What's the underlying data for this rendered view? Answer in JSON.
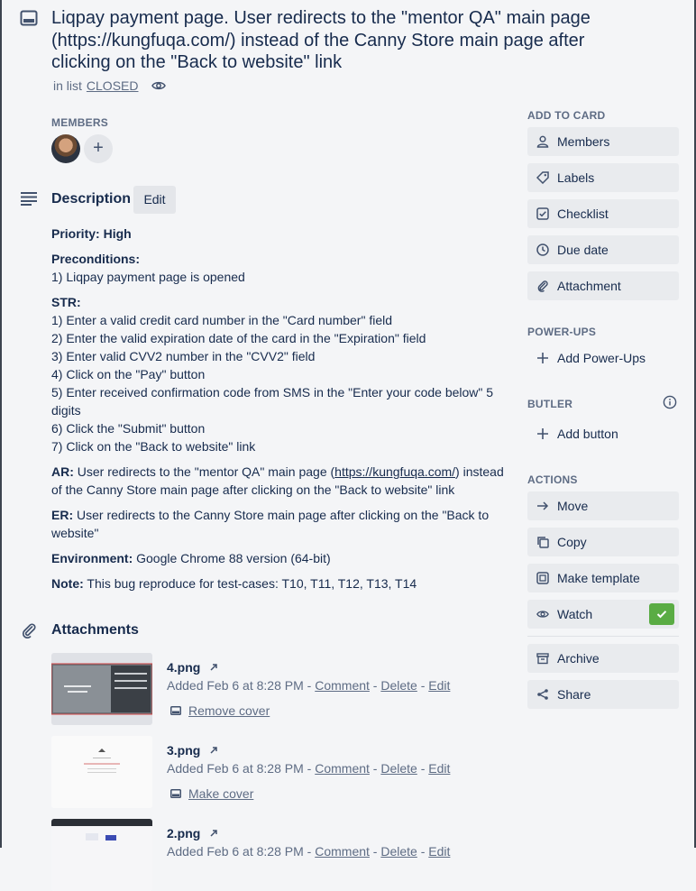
{
  "card": {
    "title": "Liqpay payment page. User redirects to the \"mentor QA\" main page (https://kungfuqa.com/) instead of the Canny Store main page after clicking on the \"Back to website\" link",
    "in_list_prefix": "in list",
    "list_name": "CLOSED"
  },
  "members": {
    "label": "MEMBERS",
    "add": "+"
  },
  "description": {
    "title": "Description",
    "edit_label": "Edit",
    "priority_label": "Priority:",
    "priority_value": "High",
    "preconditions_label": "Preconditions:",
    "preconditions": [
      "1) Liqpay payment page is opened"
    ],
    "str_label": "STR:",
    "steps": [
      "1) Enter a valid credit card number in the \"Card number\" field",
      "2) Enter the valid expiration date of the card in the \"Expiration\" field",
      "3) Enter valid CVV2 number in the \"CVV2\" field",
      "4) Click on the \"Pay\" button",
      "5) Enter received confirmation code from SMS in the \"Enter your code below\" 5 digits",
      "6) Click the \"Submit\" button",
      "7) Click on the \"Back to website\" link"
    ],
    "ar_label": "AR:",
    "ar_text_1": "User redirects to the \"mentor QA\" main page (",
    "ar_link": "https://kungfuqa.com/",
    "ar_text_2": ") instead of the Canny Store main page after clicking on the \"Back to website\" link",
    "er_label": "ER:",
    "er_text": "User redirects to the Canny Store main page after clicking on the \"Back to website\"",
    "env_label": "Environment:",
    "env_text": "Google Chrome 88 version (64-bit)",
    "note_label": "Note:",
    "note_text": "This bug reproduce for test-cases: T10, T11, T12, T13, T14"
  },
  "attachments": {
    "title": "Attachments",
    "items": [
      {
        "name": "4.png",
        "added": "Added Feb 6 at 8:28 PM - ",
        "comment": "Comment",
        "delete": "Delete",
        "edit": "Edit",
        "cover": "Remove cover"
      },
      {
        "name": "3.png",
        "added": "Added Feb 6 at 8:28 PM - ",
        "comment": "Comment",
        "delete": "Delete",
        "edit": "Edit",
        "cover": "Make cover"
      },
      {
        "name": "2.png",
        "added": "Added Feb 6 at 8:28 PM - ",
        "comment": "Comment",
        "delete": "Delete",
        "edit": "Edit",
        "cover": ""
      }
    ],
    "sep": " - "
  },
  "sidebar": {
    "add_to_card_label": "ADD TO CARD",
    "add_to_card": [
      {
        "label": "Members",
        "icon": "person-icon"
      },
      {
        "label": "Labels",
        "icon": "tag-icon"
      },
      {
        "label": "Checklist",
        "icon": "checkbox-icon"
      },
      {
        "label": "Due date",
        "icon": "clock-icon"
      },
      {
        "label": "Attachment",
        "icon": "paperclip-icon"
      }
    ],
    "powerups_label": "POWER-UPS",
    "add_powerups": "Add Power-Ups",
    "butler_label": "BUTLER",
    "add_button": "Add button",
    "actions_label": "ACTIONS",
    "actions": [
      {
        "label": "Move",
        "icon": "arrow-right-icon"
      },
      {
        "label": "Copy",
        "icon": "copy-icon"
      },
      {
        "label": "Make template",
        "icon": "template-icon"
      },
      {
        "label": "Watch",
        "icon": "eye-icon"
      }
    ],
    "archive": "Archive",
    "share": "Share"
  },
  "colors": {
    "background": "#f4f5f7",
    "button": "#e9ebee",
    "watch_check": "#5aac44",
    "text": "#172b4d",
    "muted": "#5e6c84"
  }
}
